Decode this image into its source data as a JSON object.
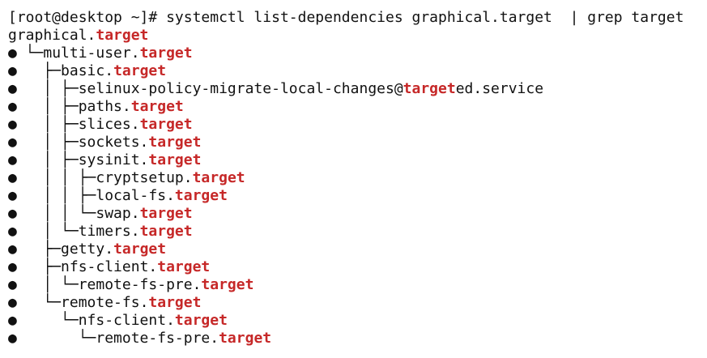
{
  "terminal": {
    "highlight_color": "#c62828",
    "text_color": "#111111",
    "background_color": "#ffffff",
    "lines": [
      {
        "prefix": "",
        "parts": [
          {
            "t": "[root@desktop ~]# systemctl list-dependencies graphical.target  | grep target",
            "hl": false
          }
        ]
      },
      {
        "prefix": "",
        "parts": [
          {
            "t": "graphical.",
            "hl": false
          },
          {
            "t": "target",
            "hl": true
          }
        ]
      },
      {
        "prefix": "● └─",
        "parts": [
          {
            "t": "multi-user.",
            "hl": false
          },
          {
            "t": "target",
            "hl": true
          }
        ]
      },
      {
        "prefix": "●   ├─",
        "parts": [
          {
            "t": "basic.",
            "hl": false
          },
          {
            "t": "target",
            "hl": true
          }
        ]
      },
      {
        "prefix": "●   │ ├─",
        "parts": [
          {
            "t": "selinux-policy-migrate-local-changes@",
            "hl": false
          },
          {
            "t": "target",
            "hl": true
          },
          {
            "t": "ed.service",
            "hl": false
          }
        ]
      },
      {
        "prefix": "●   │ ├─",
        "parts": [
          {
            "t": "paths.",
            "hl": false
          },
          {
            "t": "target",
            "hl": true
          }
        ]
      },
      {
        "prefix": "●   │ ├─",
        "parts": [
          {
            "t": "slices.",
            "hl": false
          },
          {
            "t": "target",
            "hl": true
          }
        ]
      },
      {
        "prefix": "●   │ ├─",
        "parts": [
          {
            "t": "sockets.",
            "hl": false
          },
          {
            "t": "target",
            "hl": true
          }
        ]
      },
      {
        "prefix": "●   │ ├─",
        "parts": [
          {
            "t": "sysinit.",
            "hl": false
          },
          {
            "t": "target",
            "hl": true
          }
        ]
      },
      {
        "prefix": "●   │ │ ├─",
        "parts": [
          {
            "t": "cryptsetup.",
            "hl": false
          },
          {
            "t": "target",
            "hl": true
          }
        ]
      },
      {
        "prefix": "●   │ │ ├─",
        "parts": [
          {
            "t": "local-fs.",
            "hl": false
          },
          {
            "t": "target",
            "hl": true
          }
        ]
      },
      {
        "prefix": "●   │ │ └─",
        "parts": [
          {
            "t": "swap.",
            "hl": false
          },
          {
            "t": "target",
            "hl": true
          }
        ]
      },
      {
        "prefix": "●   │ └─",
        "parts": [
          {
            "t": "timers.",
            "hl": false
          },
          {
            "t": "target",
            "hl": true
          }
        ]
      },
      {
        "prefix": "●   ├─",
        "parts": [
          {
            "t": "getty.",
            "hl": false
          },
          {
            "t": "target",
            "hl": true
          }
        ]
      },
      {
        "prefix": "●   ├─",
        "parts": [
          {
            "t": "nfs-client.",
            "hl": false
          },
          {
            "t": "target",
            "hl": true
          }
        ]
      },
      {
        "prefix": "●   │ └─",
        "parts": [
          {
            "t": "remote-fs-pre.",
            "hl": false
          },
          {
            "t": "target",
            "hl": true
          }
        ]
      },
      {
        "prefix": "●   └─",
        "parts": [
          {
            "t": "remote-fs.",
            "hl": false
          },
          {
            "t": "target",
            "hl": true
          }
        ]
      },
      {
        "prefix": "●     └─",
        "parts": [
          {
            "t": "nfs-client.",
            "hl": false
          },
          {
            "t": "target",
            "hl": true
          }
        ]
      },
      {
        "prefix": "●       └─",
        "parts": [
          {
            "t": "remote-fs-pre.",
            "hl": false
          },
          {
            "t": "target",
            "hl": true
          }
        ]
      }
    ]
  }
}
